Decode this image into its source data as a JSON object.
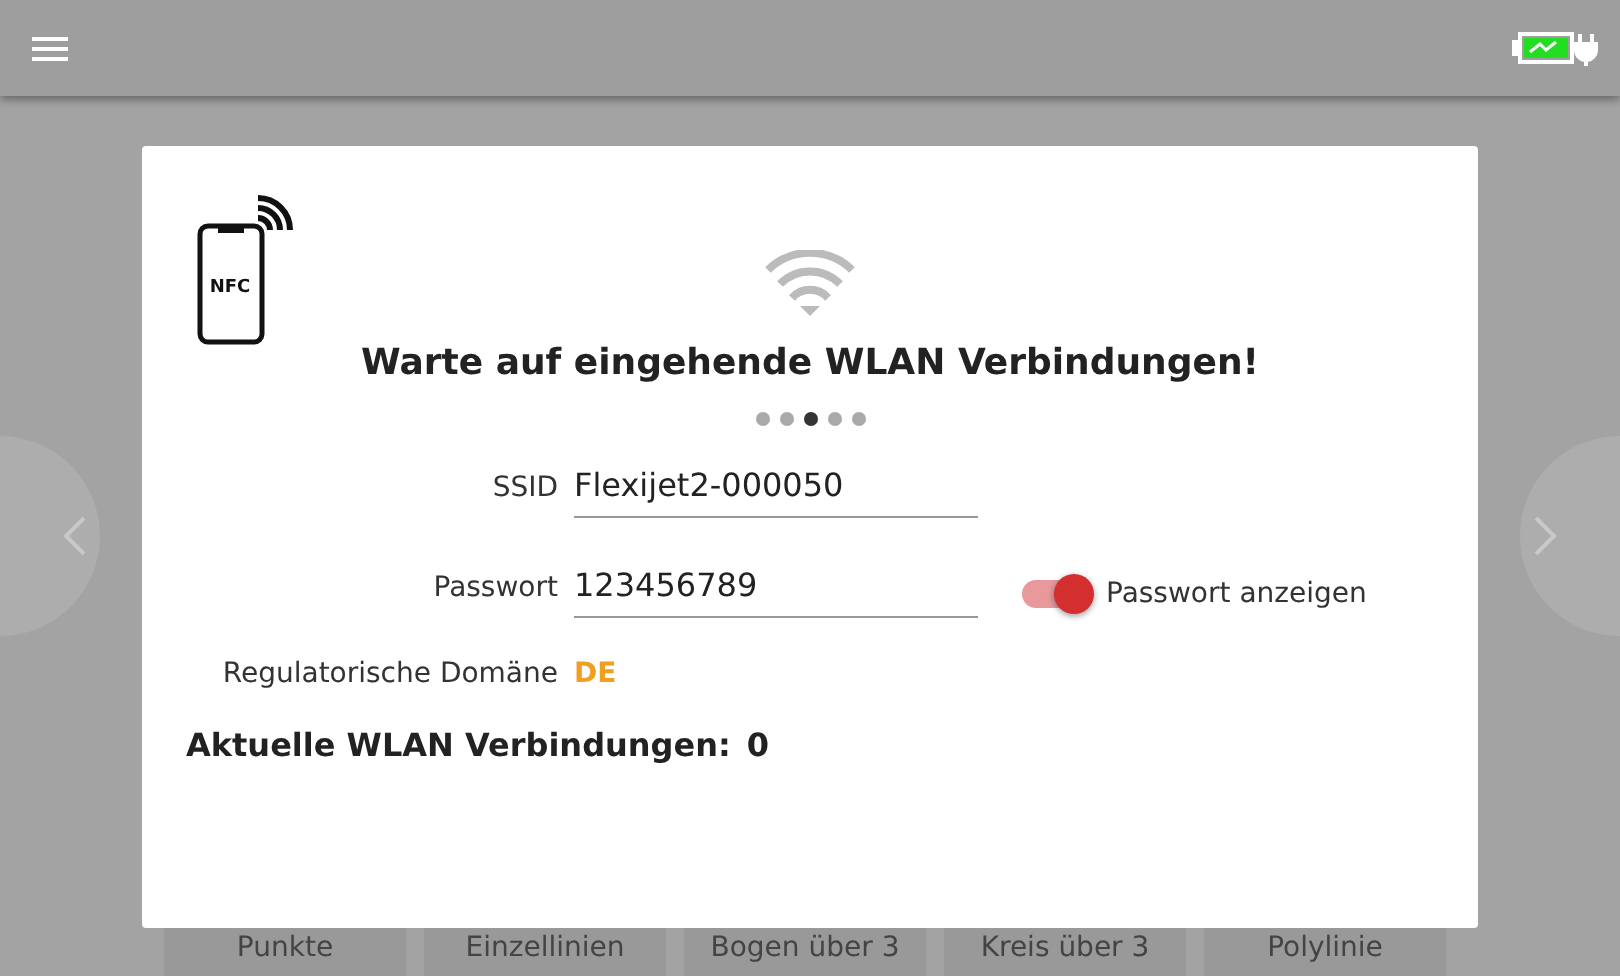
{
  "top_bar": {
    "charging": true
  },
  "nfc_badge": "NFC",
  "dialog": {
    "title": "Warte auf eingehende WLAN Verbindungen!",
    "pager": [
      {
        "selected": false
      },
      {
        "selected": false
      },
      {
        "selected": true
      },
      {
        "selected": false
      },
      {
        "selected": false
      }
    ],
    "fields": [
      {
        "label": "SSID",
        "value": "Flexijet2-000050"
      },
      {
        "label": "Passwort",
        "value": "123456789",
        "toggle": {
          "label": "Passwort anzeigen",
          "on": true
        }
      }
    ],
    "domain": {
      "label": "Regulatorische Domäne",
      "value": "DE"
    },
    "connections": {
      "label": "Aktuelle WLAN Verbindungen:",
      "value": "0"
    }
  },
  "bottom_buttons": [
    "Punkte",
    "Einzellinien",
    "Bogen über 3",
    "Kreis über 3",
    "Polylinie"
  ]
}
